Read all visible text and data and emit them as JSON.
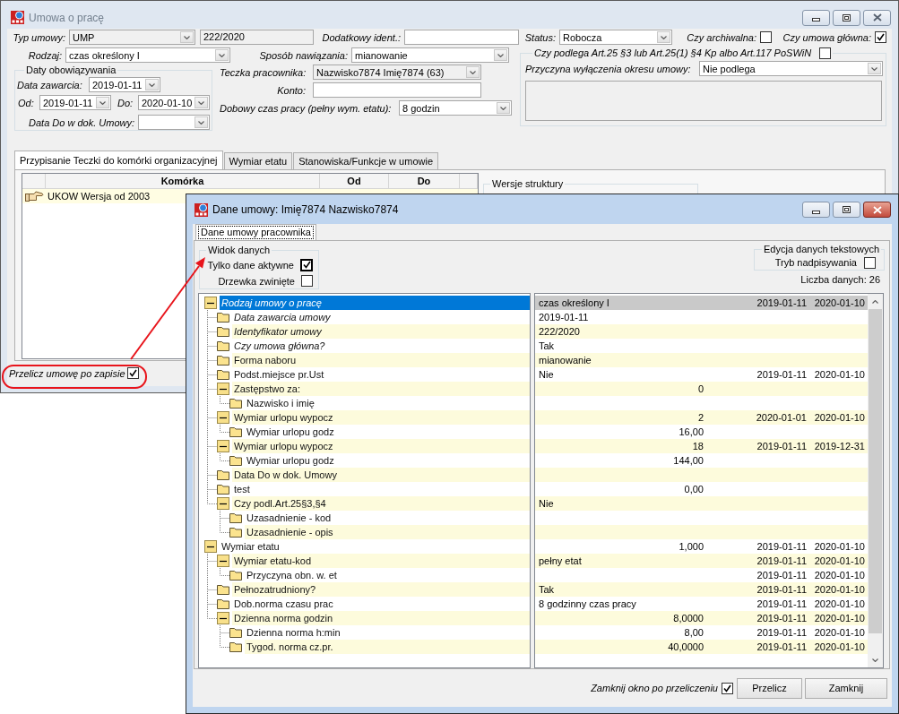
{
  "main_window": {
    "title": "Umowa o pracę",
    "active": false,
    "form": {
      "contract_type": {
        "label": "Typ umowy:",
        "value": "UMP",
        "disabled": true
      },
      "contract_number": {
        "value": "222/2020",
        "disabled": true
      },
      "additional_id": {
        "label": "Dodatkowy ident.:",
        "disabled": false
      },
      "status": {
        "label": "Status:",
        "value": "Robocza",
        "disabled": false
      },
      "archived": {
        "label": "Czy archiwalna:",
        "checked": false
      },
      "main_contract": {
        "label": "Czy umowa główna:",
        "checked": true
      },
      "contract_kind": {
        "label": "Rodzaj:",
        "value": "czas określony I",
        "disabled": false
      },
      "establishment": {
        "label": "Sposób nawiązania:",
        "value": "mianowanie",
        "disabled": false
      },
      "validity": {
        "title": "Daty obowiązywania",
        "concluded": {
          "label": "Data zawarcia:",
          "value": "2019-01-11"
        },
        "from": {
          "label": "Od:",
          "value": "2019-01-11"
        },
        "to": {
          "label": "Do:",
          "value": "2020-01-10"
        },
        "end_in_document": {
          "label": "Data Do w dok. Umowy:"
        }
      },
      "employee_file": {
        "label": "Teczka pracownika:",
        "value": "Nazwisko7874 Imię7874 (63)",
        "disabled": true
      },
      "account": {
        "label": "Konto:",
        "disabled": false
      },
      "daily_hours": {
        "label": "Dobowy czas pracy (pełny wym. etatu):",
        "value": "8 godzin",
        "disabled": false
      },
      "article_exclusion": {
        "title": "Czy podlega Art.25 §3 lub Art.25(1) §4 Kp albo Art.117 PoSWiN",
        "checked": false,
        "reason": {
          "label": "Przyczyna wyłączenia okresu umowy:",
          "value": "Nie podlega",
          "disabled": false
        },
        "note": {
          "disabled": true
        }
      }
    },
    "tabs": [
      {
        "label": "Przypisanie Teczki do komórki organizacyjnej",
        "selected": true
      },
      {
        "label": "Wymiar etatu",
        "selected": false
      },
      {
        "label": "Stanowiska/Funkcje w umowie",
        "selected": false
      }
    ],
    "unit_table": {
      "columns": [
        "Komórka",
        "Od",
        "Do"
      ],
      "rows": [
        {
          "unit": "UKOW Wersja od 2003"
        }
      ]
    },
    "structure_versions": {
      "title": "Wersje struktury"
    },
    "recalculate_after_save": {
      "label": "Przelicz umowę po zapisie",
      "checked": true
    }
  },
  "data_window": {
    "title": "Dane umowy: Imię7874 Nazwisko7874",
    "active": true,
    "tabs": [
      {
        "label": "Dane umowy pracownika",
        "selected": true
      }
    ],
    "view_group": {
      "title": "Widok danych",
      "options": [
        {
          "label": "Tylko dane aktywne",
          "checked": true,
          "focused": true
        },
        {
          "label": "Drzewka zwinięte",
          "checked": false,
          "focused": false
        }
      ]
    },
    "text_edit_group": {
      "title": "Edycja danych tekstowych",
      "overwrite": {
        "label": "Tryb nadpisywania",
        "checked": false
      }
    },
    "data_count": "Liczba danych: 26",
    "data_tree": {
      "nodes": [
        {
          "label": "Rodzaj umowy o pracę",
          "italic": true,
          "selected": true,
          "value": "czas określony I",
          "numeric": false,
          "from": "2019-01-11",
          "to": "2020-01-10",
          "expanded": true,
          "children": [
            {
              "label": "Data zawarcia umowy",
              "italic": true,
              "selected": false,
              "value": "2019-01-11",
              "numeric": false
            },
            {
              "label": "Identyfikator umowy",
              "italic": true,
              "selected": false,
              "value": "222/2020",
              "numeric": false
            },
            {
              "label": "Czy umowa główna?",
              "italic": true,
              "selected": false,
              "value": "Tak",
              "numeric": false
            },
            {
              "label": "Forma naboru",
              "italic": false,
              "selected": false,
              "value": "mianowanie",
              "numeric": false
            },
            {
              "label": "Podst.miejsce pr.Ust",
              "italic": false,
              "selected": false,
              "value": "Nie",
              "numeric": false,
              "from": "2019-01-11",
              "to": "2020-01-10"
            },
            {
              "label": "Zastępstwo za:",
              "italic": false,
              "selected": false,
              "value": "0",
              "numeric": true,
              "expanded": true,
              "children": [
                {
                  "label": "Nazwisko i imię",
                  "italic": false,
                  "selected": false
                }
              ]
            },
            {
              "label": "Wymiar urlopu wypocz",
              "italic": false,
              "selected": false,
              "value": "2",
              "numeric": true,
              "from": "2020-01-01",
              "to": "2020-01-10",
              "expanded": true,
              "children": [
                {
                  "label": "Wymiar urlopu godz",
                  "italic": false,
                  "selected": false,
                  "value": "16,00",
                  "numeric": true
                }
              ]
            },
            {
              "label": "Wymiar urlopu wypocz",
              "italic": false,
              "selected": false,
              "value": "18",
              "numeric": true,
              "from": "2019-01-11",
              "to": "2019-12-31",
              "expanded": true,
              "children": [
                {
                  "label": "Wymiar urlopu godz",
                  "italic": false,
                  "selected": false,
                  "value": "144,00",
                  "numeric": true
                }
              ]
            },
            {
              "label": "Data Do w dok. Umowy",
              "italic": false,
              "selected": false
            },
            {
              "label": "test",
              "italic": false,
              "selected": false,
              "value": "0,00",
              "numeric": true
            },
            {
              "label": "Czy podl.Art.25§3,§4",
              "italic": false,
              "selected": false,
              "value": "Nie",
              "numeric": false,
              "expanded": true,
              "children": [
                {
                  "label": "Uzasadnienie - kod",
                  "italic": false,
                  "selected": false
                },
                {
                  "label": "Uzasadnienie - opis",
                  "italic": false,
                  "selected": false
                }
              ]
            }
          ]
        },
        {
          "label": "Wymiar etatu",
          "italic": false,
          "selected": false,
          "value": "1,000",
          "numeric": true,
          "from": "2019-01-11",
          "to": "2020-01-10",
          "expanded": true,
          "children": [
            {
              "label": "Wymiar etatu-kod",
              "italic": false,
              "selected": false,
              "value": "pełny etat",
              "numeric": false,
              "from": "2019-01-11",
              "to": "2020-01-10",
              "expanded": true,
              "children": [
                {
                  "label": "Przyczyna obn. w. et",
                  "italic": false,
                  "selected": false,
                  "from": "2019-01-11",
                  "to": "2020-01-10"
                }
              ]
            },
            {
              "label": "Pełnozatrudniony?",
              "italic": false,
              "selected": false,
              "value": "Tak",
              "numeric": false,
              "from": "2019-01-11",
              "to": "2020-01-10"
            },
            {
              "label": "Dob.norma czasu prac",
              "italic": false,
              "selected": false,
              "value": "8 godzinny czas pracy",
              "numeric": false,
              "from": "2019-01-11",
              "to": "2020-01-10"
            },
            {
              "label": "Dzienna norma godzin",
              "italic": false,
              "selected": false,
              "value": "8,0000",
              "numeric": true,
              "from": "2019-01-11",
              "to": "2020-01-10",
              "expanded": true,
              "children": [
                {
                  "label": "Dzienna norma h:min",
                  "italic": false,
                  "selected": false,
                  "value": "8,00",
                  "numeric": true,
                  "from": "2019-01-11",
                  "to": "2020-01-10"
                },
                {
                  "label": "Tygod. norma cz.pr.",
                  "italic": false,
                  "selected": false,
                  "value": "40,0000",
                  "numeric": true,
                  "from": "2019-01-11",
                  "to": "2020-01-10"
                }
              ]
            }
          ]
        }
      ]
    },
    "close_after_recalc": {
      "label": "Zamknij okno po przeliczeniu",
      "checked": true
    },
    "buttons": [
      "Przelicz",
      "Zamknij"
    ]
  }
}
